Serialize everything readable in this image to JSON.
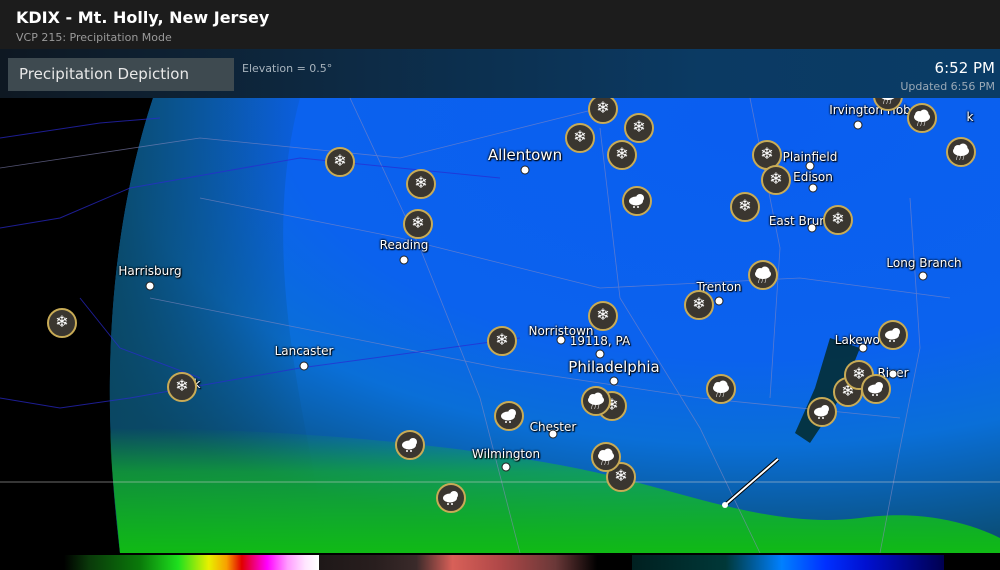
{
  "header": {
    "title": "KDIX - Mt. Holly, New Jersey",
    "subtitle": "VCP 215: Precipitation Mode"
  },
  "infobar": {
    "product_label": "Precipitation Depiction",
    "elevation": "Elevation = 0.5°",
    "scan_time": "6:52 PM",
    "updated": "Updated 6:56 PM"
  },
  "cities": [
    {
      "name": "Allentown",
      "size": "big"
    },
    {
      "name": "Reading",
      "size": "normal"
    },
    {
      "name": "Harrisburg",
      "size": "normal"
    },
    {
      "name": "Lancaster",
      "size": "normal"
    },
    {
      "name": "Norristown",
      "size": "normal"
    },
    {
      "name": "19118, PA",
      "size": "normal"
    },
    {
      "name": "Philadelphia",
      "size": "big"
    },
    {
      "name": "Chester",
      "size": "normal"
    },
    {
      "name": "Wilmington",
      "size": "normal"
    },
    {
      "name": "Trenton",
      "size": "normal"
    },
    {
      "name": "Plainfield",
      "size": "normal"
    },
    {
      "name": "Edison",
      "size": "normal"
    },
    {
      "name": "East Bruns",
      "size": "normal"
    },
    {
      "name": "Irvington Hob",
      "size": "normal"
    },
    {
      "name": "Long Branch",
      "size": "normal"
    },
    {
      "name": "Lakewoo",
      "size": "normal"
    },
    {
      "name": "River",
      "size": "normal"
    },
    {
      "name": "k",
      "size": "normal"
    },
    {
      "name": "k",
      "size": "normal"
    }
  ],
  "weather_markers": [
    {
      "type": "snow-icon"
    },
    {
      "type": "snow-icon"
    },
    {
      "type": "snow-icon"
    },
    {
      "type": "snow-icon"
    },
    {
      "type": "snow-icon"
    },
    {
      "type": "snow-icon"
    },
    {
      "type": "snow-icon"
    },
    {
      "type": "snow-icon"
    },
    {
      "type": "snow-icon"
    },
    {
      "type": "snow-icon"
    },
    {
      "type": "snow-icon"
    },
    {
      "type": "snow-icon"
    },
    {
      "type": "snow-icon"
    },
    {
      "type": "snow-icon"
    },
    {
      "type": "snow-icon"
    },
    {
      "type": "snow-icon"
    },
    {
      "type": "snow-icon"
    },
    {
      "type": "snow-icon"
    },
    {
      "type": "snow-icon"
    },
    {
      "type": "snow-icon"
    },
    {
      "type": "cloud-sleet-icon"
    },
    {
      "type": "cloud-sleet-icon"
    },
    {
      "type": "cloud-sleet-icon"
    },
    {
      "type": "cloud-sleet-icon"
    },
    {
      "type": "cloud-sleet-icon"
    },
    {
      "type": "cloud-sleet-icon"
    },
    {
      "type": "cloud-sleet-icon"
    },
    {
      "type": "partly-cloudy-rain-icon"
    },
    {
      "type": "partly-cloudy-rain-icon"
    },
    {
      "type": "partly-cloudy-rain-icon"
    },
    {
      "type": "partly-cloudy-rain-icon"
    },
    {
      "type": "partly-cloudy-rain-icon"
    },
    {
      "type": "partly-cloudy-rain-icon"
    },
    {
      "type": "partly-cloudy-rain-icon"
    }
  ],
  "legend": {
    "colors": {
      "rain": [
        "#0a3a0a",
        "#1ee01e",
        "#e8f000",
        "#f8a000",
        "#e00000",
        "#ff00ff",
        "#ffffff"
      ],
      "mix": [
        "#281e1e",
        "#d86058",
        "#6a3838"
      ],
      "snow": [
        "#003838",
        "#0080ff",
        "#0030ff",
        "#000050"
      ]
    }
  }
}
